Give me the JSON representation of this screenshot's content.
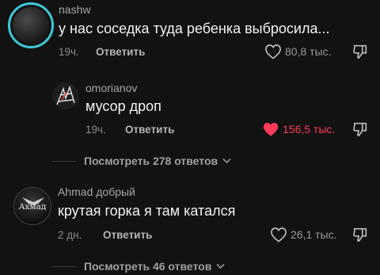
{
  "comments": [
    {
      "username": "nashw",
      "text": "у нас соседка туда ребенка выбросила...",
      "time": "19ч.",
      "reply_label": "Ответить",
      "likes": "80,8 тыс.",
      "liked": false
    },
    {
      "username": "omorianov",
      "text": "мусор дроп",
      "time": "19ч.",
      "reply_label": "Ответить",
      "likes": "156,5 тыс.",
      "liked": true
    },
    {
      "username": "Ahmad добрый",
      "text": "крутая горка я там катался",
      "time": "2 дн.",
      "reply_label": "Ответить",
      "likes": "26,1 тыс.",
      "liked": false,
      "avatar_text": "Ахмад"
    }
  ],
  "view_replies": [
    "Посмотреть 278 ответов",
    "Посмотреть 46 ответов"
  ],
  "colors": {
    "background": "#121212",
    "liked_heart": "#ff3b5c",
    "story_ring": "#3fc7d6"
  },
  "icons": [
    "heart-outline-icon",
    "heart-filled-icon",
    "dislike-icon",
    "chevron-down-icon"
  ]
}
